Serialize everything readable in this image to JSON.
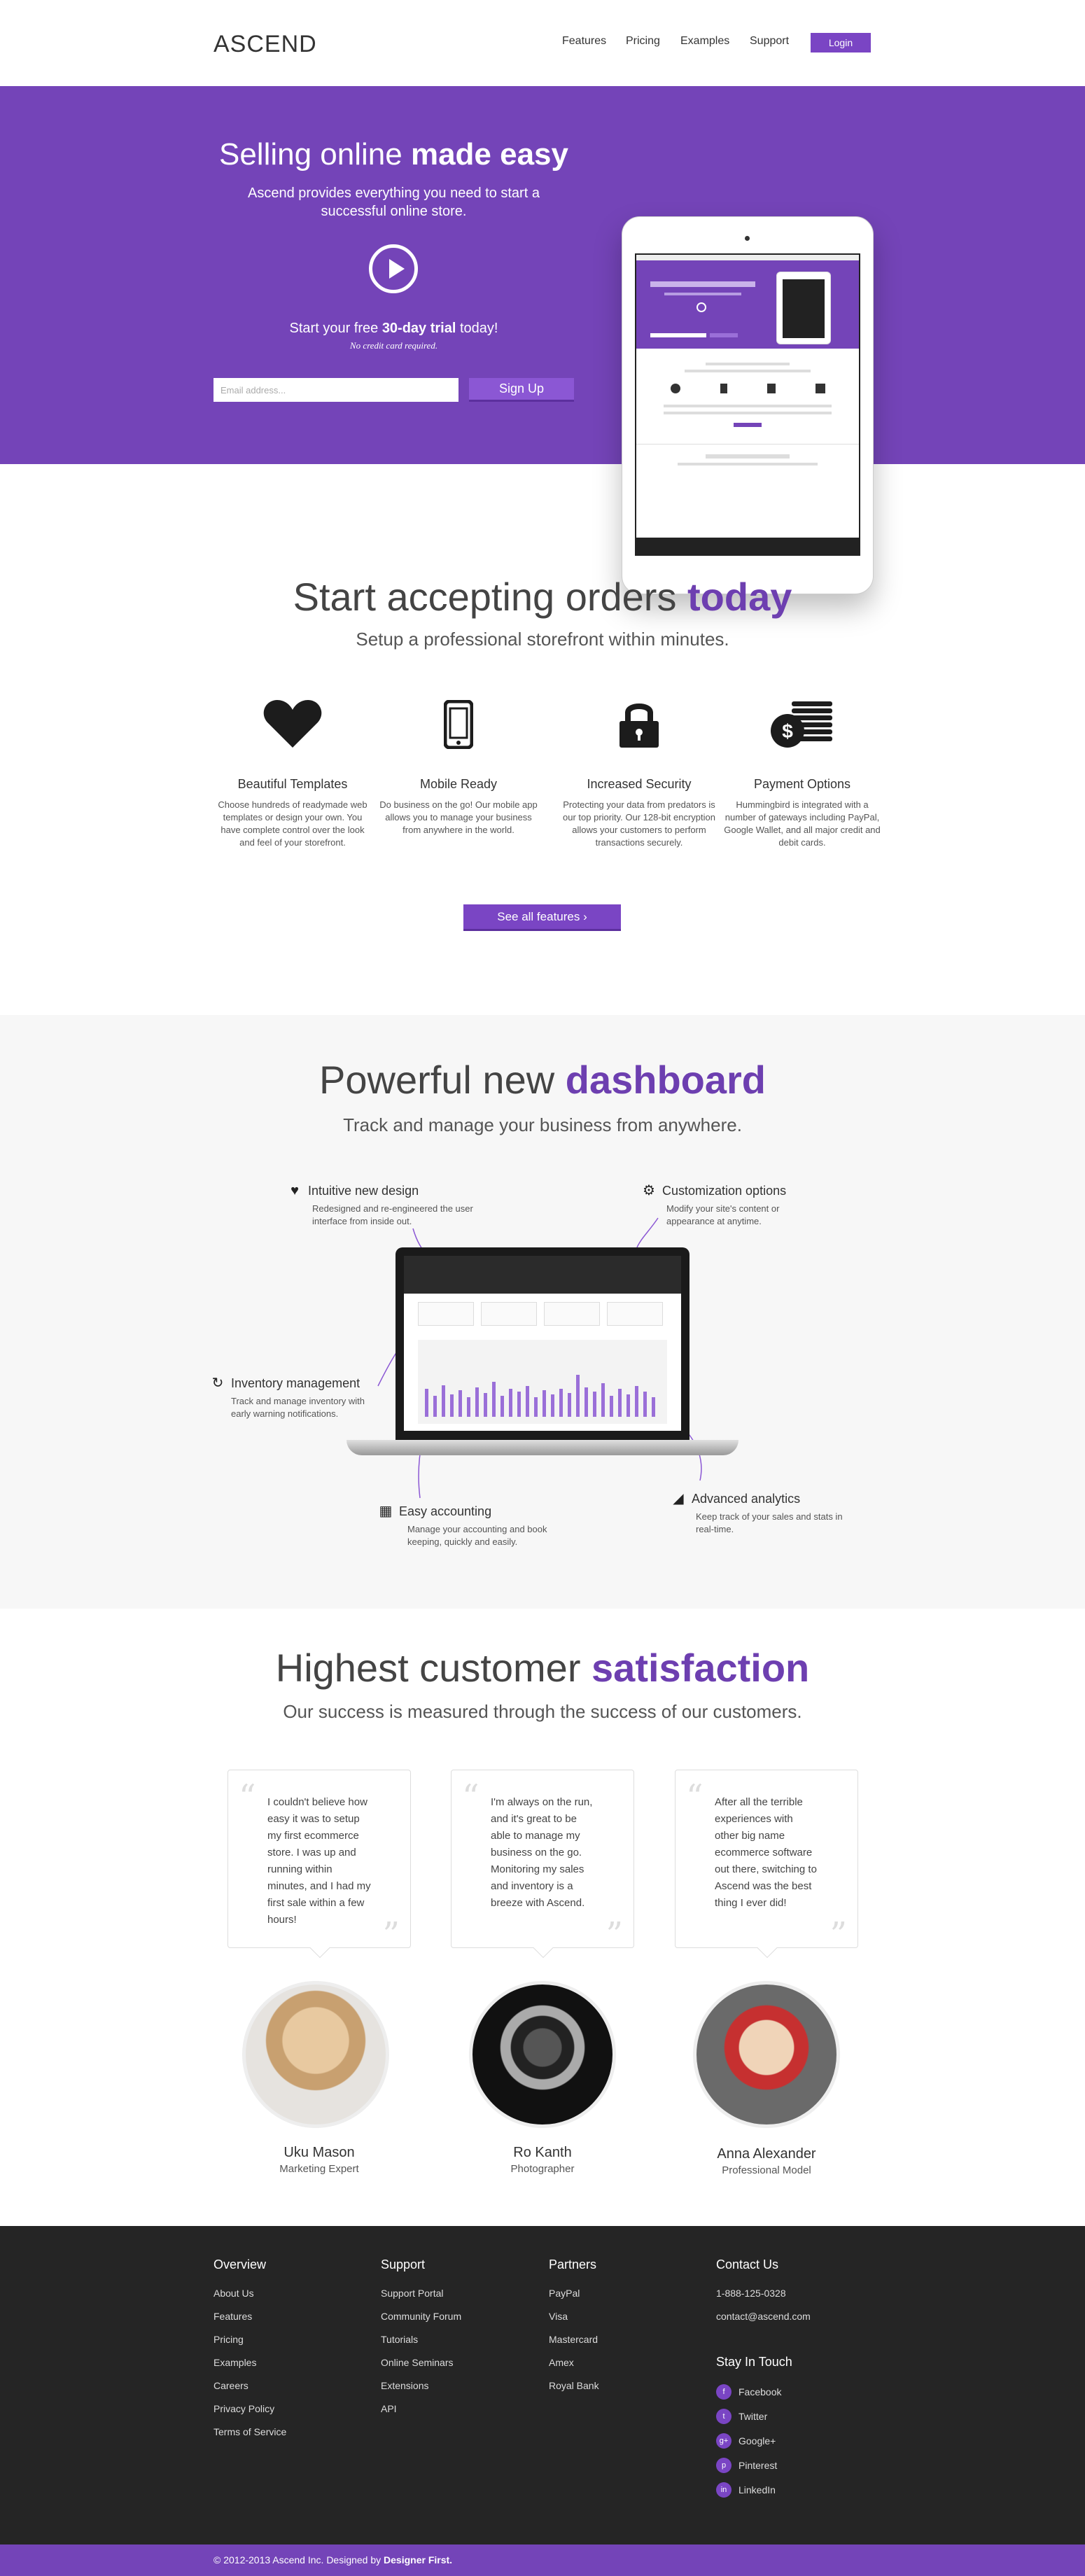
{
  "nav": {
    "logo": "ASCEND",
    "links": [
      "Features",
      "Pricing",
      "Examples",
      "Support"
    ],
    "login_label": "Login"
  },
  "hero": {
    "title_plain": "Selling online ",
    "title_bold": "made easy",
    "subtitle": "Ascend provides everything you need to start a successful online store.",
    "trial_pre": "Start your free ",
    "trial_bold": "30-day trial",
    "trial_post": " today!",
    "no_card": "No credit card required.",
    "email_placeholder": "Email address...",
    "signup_label": "Sign Up"
  },
  "features": {
    "title_plain": "Start accepting orders ",
    "title_bold": "today",
    "subtitle": "Setup a professional storefront within minutes.",
    "items": [
      {
        "icon": "heart-icon",
        "title": "Beautiful Templates",
        "text": "Choose hundreds of readymade web templates or design your own. You have complete control over the look and feel of your storefront."
      },
      {
        "icon": "mobile-icon",
        "title": "Mobile Ready",
        "text": "Do business on the go! Our mobile app allows you to manage your business from anywhere in the world."
      },
      {
        "icon": "lock-icon",
        "title": "Increased Security",
        "text": "Protecting your data from predators is our top priority. Our 128-bit encryption allows your customers to perform transactions securely."
      },
      {
        "icon": "coins-icon",
        "title": "Payment Options",
        "text": "Hummingbird is integrated with a number of gateways including PayPal, Google Wallet, and all major credit and debit cards."
      }
    ],
    "see_all_label": "See all features  ›"
  },
  "dashboard": {
    "title_plain": "Powerful new ",
    "title_bold": "dashboard",
    "subtitle": "Track and manage your business from anywhere.",
    "callouts": {
      "intuitive": {
        "title": "Intuitive new design",
        "text": "Redesigned and re-engineered the user interface from inside out."
      },
      "custom": {
        "title": "Customization options",
        "text": "Modify your site's content or appearance at anytime."
      },
      "inventory": {
        "title": "Inventory management",
        "text": "Track and manage inventory with early warning notifications."
      },
      "accounting": {
        "title": "Easy accounting",
        "text": "Manage your accounting and book keeping, quickly and easily."
      },
      "analytics": {
        "title": "Advanced analytics",
        "text": "Keep track of your sales and stats in real-time."
      }
    }
  },
  "testimonials": {
    "title_plain": "Highest customer ",
    "title_bold": "satisfaction",
    "subtitle": "Our success is measured through the success of our customers.",
    "items": [
      {
        "quote": "I couldn't believe how easy it was to setup my first ecommerce store. I was up and running within minutes, and I had my first sale within a few hours!",
        "name": "Uku Mason",
        "role": "Marketing Expert"
      },
      {
        "quote": "I'm always on the run, and it's great to be able to manage my business on the go. Monitoring my sales and inventory is a breeze with Ascend.",
        "name": "Ro Kanth",
        "role": "Photographer"
      },
      {
        "quote": "After all the terrible experiences with other big name ecommerce software out there, switching to Ascend was the best thing I ever did!",
        "name": "Anna Alexander",
        "role": "Professional Model"
      }
    ]
  },
  "footer": {
    "overview": {
      "title": "Overview",
      "links": [
        "About Us",
        "Features",
        "Pricing",
        "Examples",
        "Careers",
        "Privacy Policy",
        "Terms of Service"
      ]
    },
    "support": {
      "title": "Support",
      "links": [
        "Support Portal",
        "Community Forum",
        "Tutorials",
        "Online Seminars",
        "Extensions",
        "API"
      ]
    },
    "partners": {
      "title": "Partners",
      "links": [
        "PayPal",
        "Visa",
        "Mastercard",
        "Amex",
        "Royal Bank"
      ]
    },
    "contact": {
      "title": "Contact Us",
      "phone": "1-888-125-0328",
      "email": "contact@ascend.com"
    },
    "social": {
      "title": "Stay In Touch",
      "links": [
        {
          "icon": "facebook-icon",
          "label": "Facebook"
        },
        {
          "icon": "twitter-icon",
          "label": "Twitter"
        },
        {
          "icon": "googleplus-icon",
          "label": "Google+"
        },
        {
          "icon": "pinterest-icon",
          "label": "Pinterest"
        },
        {
          "icon": "linkedin-icon",
          "label": "LinkedIn"
        }
      ]
    },
    "copyright_pre": "© 2012-2013 Ascend Inc.  Designed by ",
    "copyright_bold": "Designer First."
  },
  "colors": {
    "brand_purple": "#7444b8",
    "dark_footer": "#252525"
  }
}
